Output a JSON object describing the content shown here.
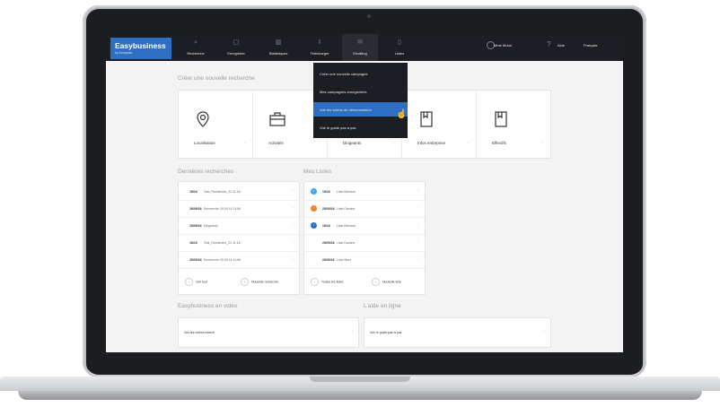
{
  "app": {
    "brand": "Easybusiness",
    "brand_sub": "by Kompass"
  },
  "nav": [
    {
      "label": "Recherche",
      "icon": "search-icon"
    },
    {
      "label": "Enregistrer",
      "icon": "save-icon"
    },
    {
      "label": "Statistiques",
      "icon": "chart-icon"
    },
    {
      "label": "Télécharger",
      "icon": "download-icon"
    },
    {
      "label": "Emailing",
      "icon": "mail-icon"
    },
    {
      "label": "Listes",
      "icon": "list-icon"
    }
  ],
  "user": {
    "name": "Mme Motor",
    "help": "Aide",
    "language": "Français"
  },
  "dropdown": {
    "items": [
      "Créer une nouvelle campagne",
      "Mes campagnes enregistrées",
      "Voir les vidéos de démonstration",
      "Voir le guide pas à pas"
    ]
  },
  "new_search": {
    "title": "Créer une nouvelle recherche",
    "cards": [
      "Localisation",
      "Activités",
      "Dirigeants",
      "Infos entreprise",
      "Effectifs"
    ]
  },
  "recent": {
    "title": "Dernières recherches",
    "rows": [
      {
        "date": "18/16",
        "text": "Test_Recherche_22.11.16"
      },
      {
        "date": "28/09/16",
        "text": "Recherche 29.09.16 11:56"
      },
      {
        "date": "28/09/16",
        "text": "Dirigeants"
      },
      {
        "date": "18/16",
        "text": "Test_Recherche_22.11.16"
      },
      {
        "date": "28/09/16",
        "text": "Recherche 29.09.16 11:56"
      }
    ],
    "btn_all": "Voir tout",
    "btn_new": "Nouvelle recherche"
  },
  "lists": {
    "title": "Mes Listes",
    "rows": [
      {
        "date": "18/16",
        "text": "Liste Bernard",
        "badge": "#3fa8e0"
      },
      {
        "date": "28/09/16",
        "text": "Liste Darsine",
        "badge": "#e8852d"
      },
      {
        "date": "18/16",
        "text": "Liste Bernard",
        "badge": "#2e6fc4"
      },
      {
        "date": "28/09/16",
        "text": "Liste Darsine",
        "badge": ""
      },
      {
        "date": "28/09/16",
        "text": "Liste Mars",
        "badge": ""
      }
    ],
    "btn_all": "Toutes les listes",
    "btn_new": "Nouvelle liste"
  },
  "video": {
    "title": "Easybusiness en vidéo",
    "link": "Voir les vidéos tutoriel"
  },
  "help_online": {
    "title": "L'aide en ligne",
    "link": "Voir le guide pas à pas"
  },
  "colors": {
    "brand": "#2e6fc4",
    "topbar": "#1d1e24",
    "highlight": "#2e6fc4"
  }
}
